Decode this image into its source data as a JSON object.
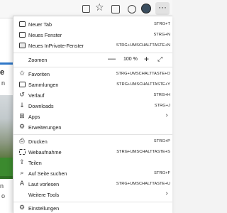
{
  "toolbar": {
    "more_label": "···"
  },
  "page": {
    "text_e": "e",
    "text_n1": "n",
    "text_n2": "n",
    "text_o": "o"
  },
  "menu": {
    "items": [
      {
        "label": "Neuer Tab",
        "shortcut": "STRG+T",
        "icon": "new-tab-icon"
      },
      {
        "label": "Neues Fenster",
        "shortcut": "STRG+N",
        "icon": "new-window-icon"
      },
      {
        "label": "Neues InPrivate-Fenster",
        "shortcut": "STRG+UMSCHALTTASTE+N",
        "icon": "inprivate-icon"
      },
      {
        "label": "Zoomen",
        "icon": ""
      },
      {
        "label": "Favoriten",
        "shortcut": "STRG+UMSCHALTTASTE+O",
        "icon": "favorites-icon"
      },
      {
        "label": "Sammlungen",
        "shortcut": "STRG+UMSCHALTTASTE+Y",
        "icon": "collections-icon"
      },
      {
        "label": "Verlauf",
        "shortcut": "STRG+H",
        "icon": "history-icon"
      },
      {
        "label": "Downloads",
        "shortcut": "STRG+J",
        "icon": "downloads-icon"
      },
      {
        "label": "Apps",
        "icon": "apps-icon"
      },
      {
        "label": "Erweiterungen",
        "icon": "extensions-icon"
      },
      {
        "label": "Drucken",
        "shortcut": "STRG+P",
        "icon": "print-icon"
      },
      {
        "label": "Webaufnahme",
        "shortcut": "STRG+UMSCHALTTASTE+S",
        "icon": "web-capture-icon"
      },
      {
        "label": "Teilen",
        "icon": "share-icon"
      },
      {
        "label": "Auf Seite suchen",
        "shortcut": "STRG+F",
        "icon": "find-icon"
      },
      {
        "label": "Laut vorlesen",
        "shortcut": "STRG+UMSCHALTTASTE+U",
        "icon": "read-aloud-icon"
      },
      {
        "label": "Weitere Tools",
        "icon": ""
      },
      {
        "label": "Einstellungen",
        "icon": "settings-icon"
      }
    ],
    "zoom": {
      "minus": "—",
      "value": "100 %",
      "plus": "+"
    }
  }
}
